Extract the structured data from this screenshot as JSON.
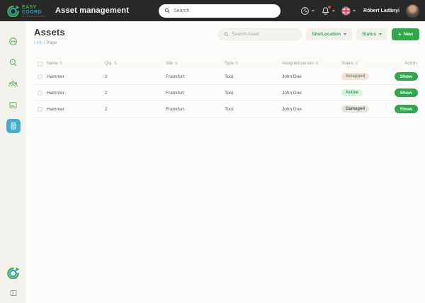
{
  "topbar": {
    "logo": {
      "line1": "EASY",
      "line2": "COORD"
    },
    "title": "Asset management",
    "search": {
      "placeholder": "Search"
    },
    "user": {
      "name": "Róbert Ladányi"
    }
  },
  "sidebar": {
    "icons": [
      "chat-icon",
      "search-help-icon",
      "team-icon",
      "card-icon",
      "assets-list-icon",
      "easycoord-logo-icon",
      "collapse-sidebar-icon"
    ],
    "active_item": "assets-list-icon",
    "active_color": "#41aecd"
  },
  "page": {
    "title": "Assets",
    "breadcrumb": {
      "link": "Link",
      "separator": " / ",
      "current": "Page"
    }
  },
  "controls": {
    "search_placeholder": "Search Asset",
    "site_location_label": "Site/Location",
    "status_label": "Status",
    "new_plus": "+",
    "new_label": "New"
  },
  "table": {
    "sort_glyph": "⇅",
    "columns": [
      {
        "label": "Name",
        "sortable": true
      },
      {
        "label": "Qty.",
        "sortable": true
      },
      {
        "label": "Site",
        "sortable": true
      },
      {
        "label": "Type",
        "sortable": true
      },
      {
        "label": "Assigned person",
        "sortable": true
      },
      {
        "label": "Status",
        "sortable": true
      },
      {
        "label": "Action",
        "sortable": false
      }
    ],
    "rows": [
      {
        "name": "Hammer",
        "qty": "2",
        "site": "Frankfurt",
        "type": "Tool.",
        "assigned_person": "John Doe",
        "status": "Scrapped",
        "status_variant": "scrapped",
        "action": "Show"
      },
      {
        "name": "Hammer",
        "qty": "2",
        "site": "Frankfurt",
        "type": "Tool.",
        "assigned_person": "John Doe",
        "status": "Active",
        "status_variant": "active",
        "action": "Show"
      },
      {
        "name": "Hammer",
        "qty": "2",
        "site": "Frankfurt",
        "type": "Tool.",
        "assigned_person": "John Doe",
        "status": "Damaged",
        "status_variant": "damaged",
        "action": "Show"
      }
    ]
  },
  "colors": {
    "topbar_bg": "#282828",
    "brand_green": "#2fa84c",
    "logo_green": "#3fae49",
    "logo_teal": "#2f9fc0",
    "sidebar_bg": "#f4f2ec",
    "sidebar_active_bg": "#41aecd",
    "badge_scrapped_bg": "#fadddd",
    "badge_scrapped_text": "#5da95f",
    "badge_active_bg": "#d8f3e1",
    "badge_active_text": "#34a853",
    "badge_damaged_bg": "#e3e3e0",
    "badge_damaged_text": "#5f5f5f",
    "breadcrumb_link": "#8ed1ea",
    "notification_dot": "#e03c31"
  }
}
